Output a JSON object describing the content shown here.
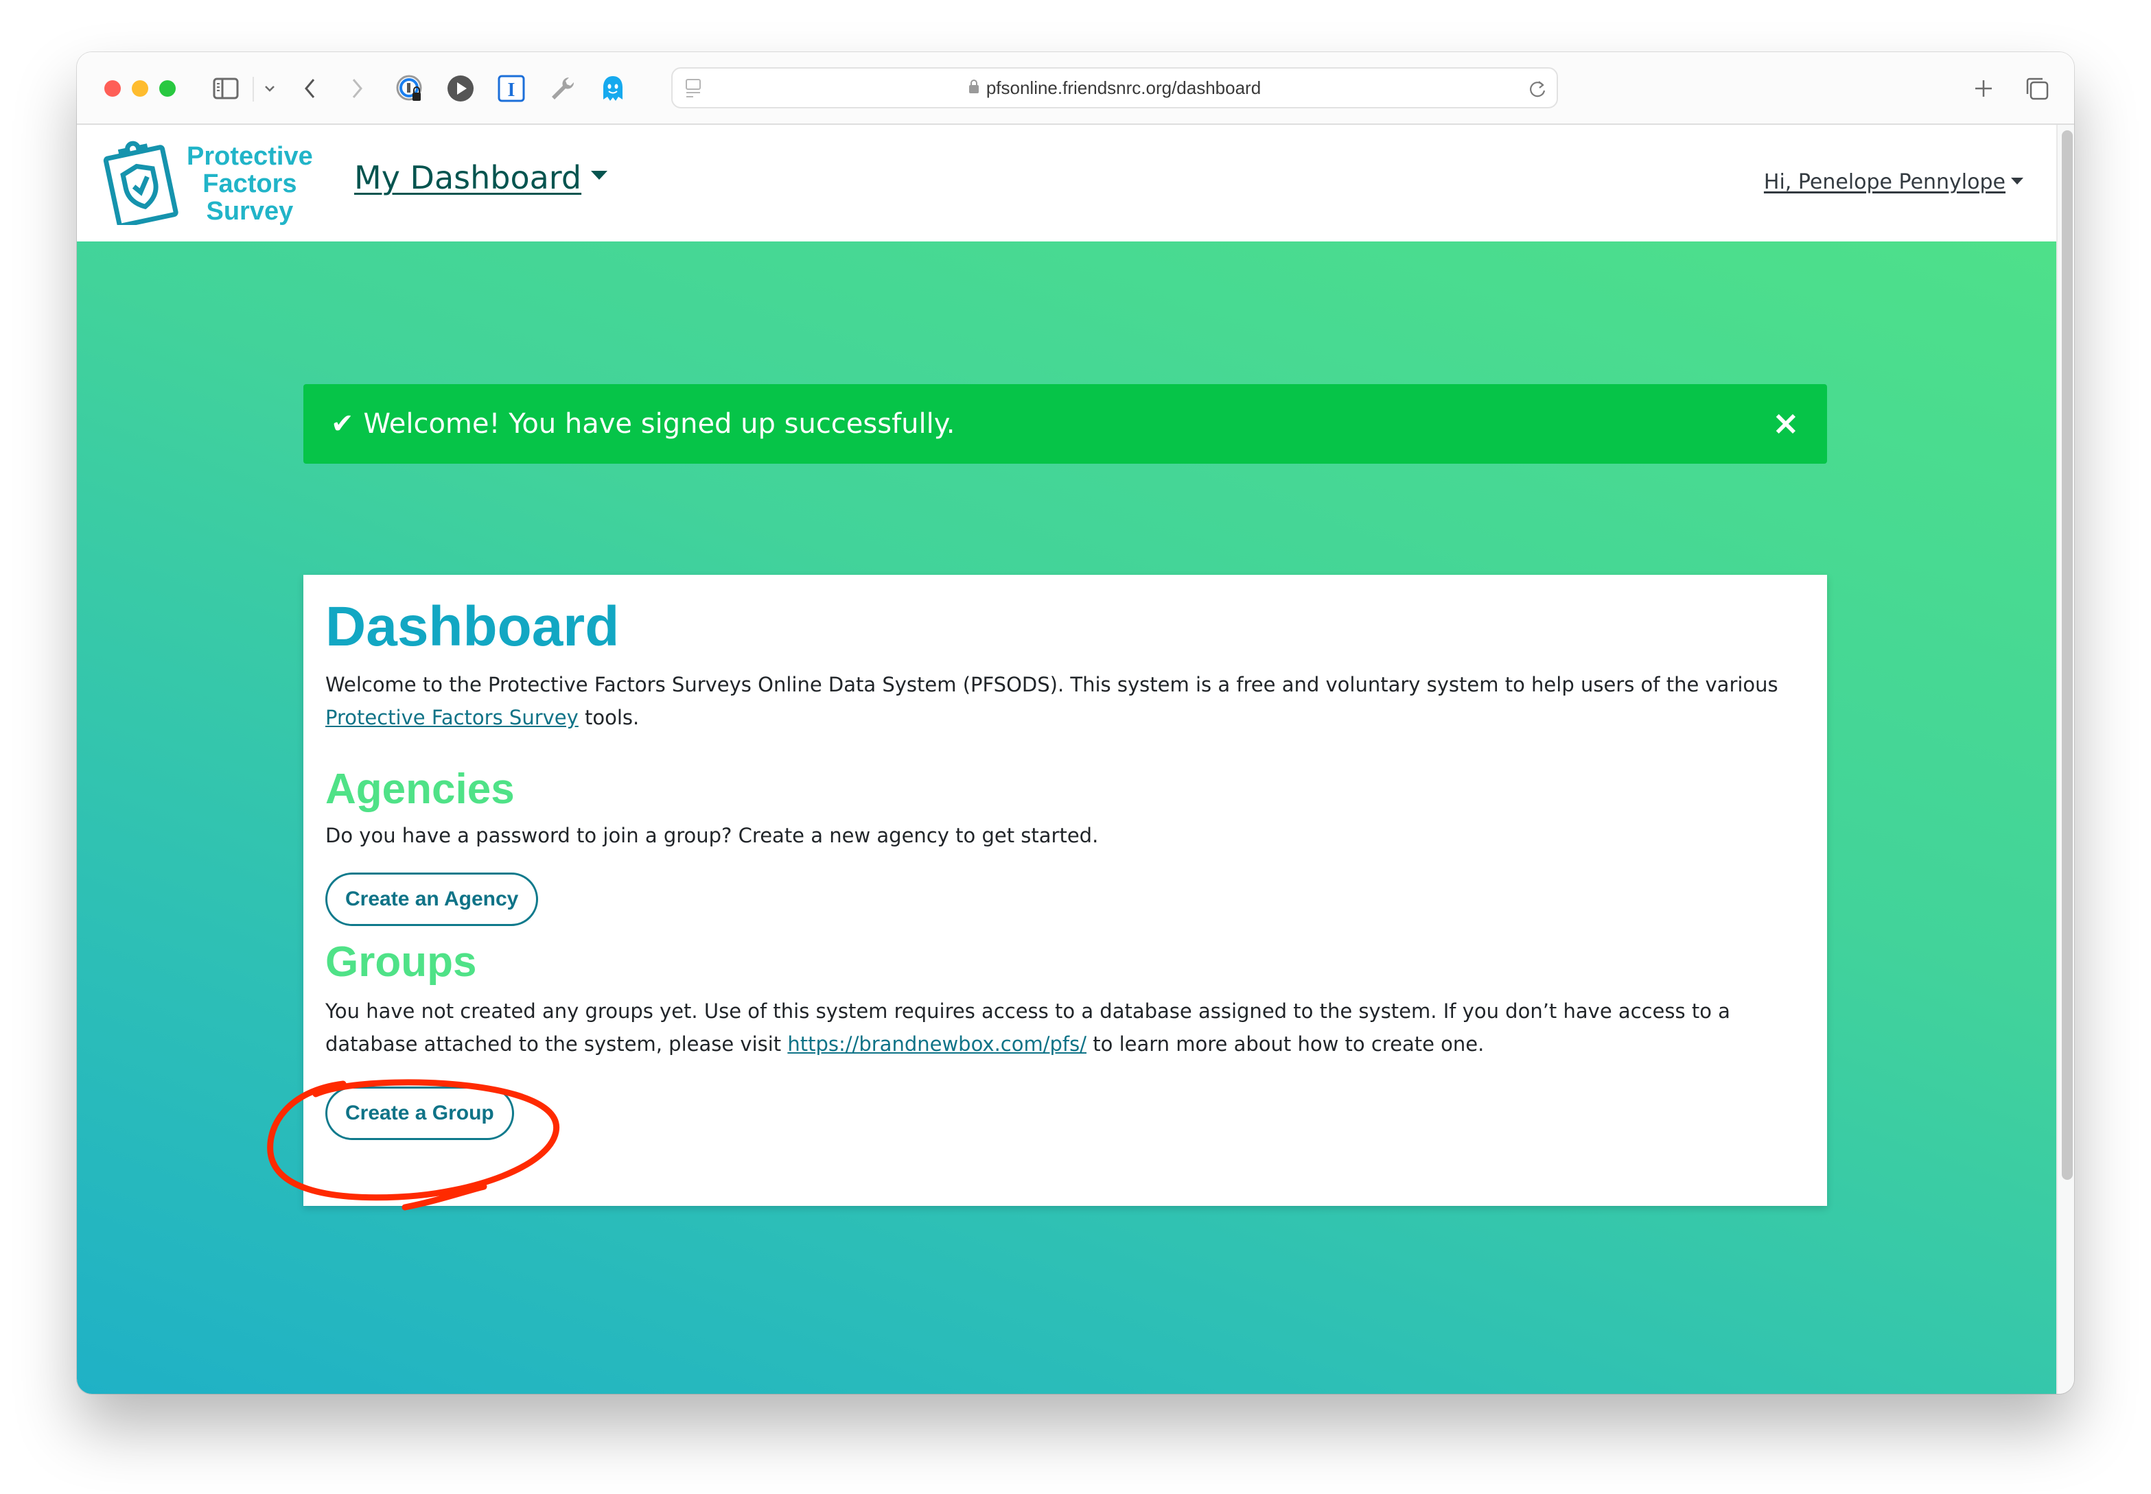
{
  "browser": {
    "url": "pfsonline.friendsnrc.org/dashboard",
    "toolbar_icons": [
      "sidebar-icon",
      "chevron-down-icon",
      "back-icon",
      "forward-icon",
      "password-manager-icon",
      "play-icon",
      "instapaper-icon",
      "wrench-icon",
      "ghostery-icon"
    ],
    "right_icons": [
      "new-tab-icon",
      "tab-overview-icon"
    ]
  },
  "header": {
    "logo_lines": [
      "Protective",
      "Factors",
      "Survey"
    ],
    "nav_label": "My Dashboard",
    "user_label": "Hi, Penelope Pennylope"
  },
  "alert": {
    "icon": "check-icon",
    "message": "Welcome! You have signed up successfully.",
    "close": "×"
  },
  "dashboard": {
    "title": "Dashboard",
    "intro_text": "Welcome to the Protective Factors Surveys Online Data System (PFSODS). This system is a free and voluntary system to help users of the various ",
    "intro_link": "Protective Factors Survey",
    "intro_suffix": " tools.",
    "agencies": {
      "heading": "Agencies",
      "text": "Do you have a password to join a group? Create a new agency to get started.",
      "button": "Create an Agency"
    },
    "groups": {
      "heading": "Groups",
      "text": "You have not created any groups yet. Use of this system requires access to a database assigned to the system. If you don’t have access to a database attached to the system, please visit ",
      "link": "https://brandnewbox.com/pfs/",
      "suffix": " to learn more about how to create one.",
      "button": "Create a Group"
    }
  },
  "colors": {
    "brand_teal": "#12a7c3",
    "heading_green": "#4fe287",
    "alert_green": "#06c448",
    "button_teal": "#0f7387",
    "nav_dark": "#05544f",
    "annotation_red": "#ff2a00"
  }
}
